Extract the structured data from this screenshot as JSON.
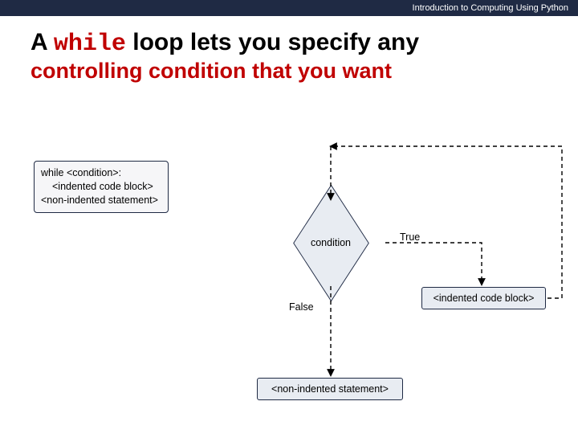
{
  "header": {
    "text": "Introduction to Computing Using Python"
  },
  "title": {
    "prefix": "A ",
    "keyword": "while",
    "suffix": " loop lets you specify any",
    "line2": "controlling condition that you want"
  },
  "code": {
    "l1": "while <condition>:",
    "l2": "<indented code block>",
    "l3": "<non-indented statement>"
  },
  "flow": {
    "condition": "condition",
    "trueLabel": "True",
    "falseLabel": "False",
    "indentedBlock": "<indented code block>",
    "nonIndented": "<non-indented statement>"
  }
}
